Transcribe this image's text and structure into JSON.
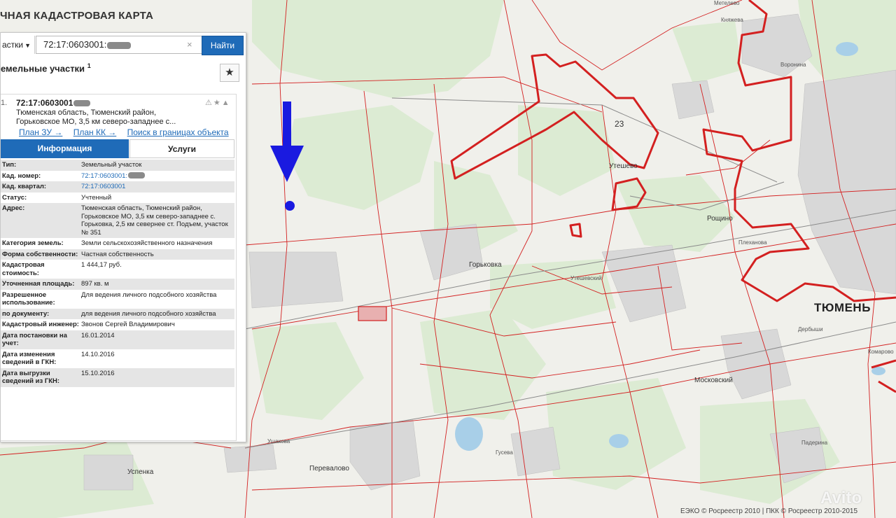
{
  "header": {
    "title": "ЧНАЯ КАДАСТРОВАЯ КАРТА"
  },
  "search": {
    "type_select": "астки",
    "value": "72:17:0603001:",
    "clear_glyph": "×",
    "button": "Найти"
  },
  "results": {
    "heading": "емельные участки",
    "count": "1",
    "star_glyph": "★"
  },
  "card": {
    "index": "1.",
    "id": "72:17:0603001",
    "address": "Тюменская область, Тюменский район, Горьковское МО, 3,5 км северо-западнее с...",
    "icons": "⚠★▲",
    "links": [
      "План ЗУ →",
      "План КК →",
      "Поиск в границах объекта →"
    ]
  },
  "tabs": [
    {
      "label": "Информация",
      "active": true
    },
    {
      "label": "Услуги",
      "active": false
    }
  ],
  "info": [
    {
      "key": "Тип:",
      "value": "Земельный участок"
    },
    {
      "key": "Кад. номер:",
      "value": "72:17:0603001:",
      "masked": true,
      "link": true
    },
    {
      "key": "Кад. квартал:",
      "value": "72:17:0603001",
      "link": true
    },
    {
      "key": "Статус:",
      "value": "Учтенный"
    },
    {
      "key": "Адрес:",
      "value": "Тюменская область, Тюменский район, Горьковское МО, 3,5 км северо-западнее с. Горьковка, 2,5 км севернее ст. Подъем, участок № 351"
    },
    {
      "key": "Категория земель:",
      "value": "Земли сельскохозяйственного назначения"
    },
    {
      "key": "Форма собственности:",
      "value": "Частная собственность"
    },
    {
      "key": "Кадастровая стоимость:",
      "value": "1 444,17 руб."
    },
    {
      "key": "Уточненная площадь:",
      "value": "897 кв. м"
    },
    {
      "key": "Разрешенное использование:",
      "value": "Для ведения личного подсобного хозяйства"
    },
    {
      "key": "по документу:",
      "value": "для ведения личного подсобного хозяйства"
    },
    {
      "key": "Кадастровый инженер:",
      "value": "Звонов Сергей Владимирович"
    },
    {
      "key": "Дата постановки на учет:",
      "value": "16.01.2014"
    },
    {
      "key": "Дата изменения сведений в ГКН:",
      "value": "14.10.2016"
    },
    {
      "key": "Дата выгрузки сведений из ГКН:",
      "value": "15.10.2016"
    }
  ],
  "map": {
    "labels": {
      "metelevo": "Метелево",
      "knyazheva": "Княжева",
      "voronina": "Воронина",
      "utesheva": "Утешево",
      "roschino": "Рощино",
      "plekhanova": "Плеханова",
      "gorkovka": "Горьковка",
      "utesheva_small": "Утешевский",
      "tyumen": "ТЮМЕНЬ",
      "derbyshi": "Дербыши",
      "komarovo": "Комарово",
      "moskovsky": "Московский",
      "paderina": "Падерина",
      "ushakova": "Ушакова",
      "uspenka": "Успенка",
      "perevalovo": "Перевалово",
      "guseva": "Гусева",
      "block_num": "23"
    },
    "attribution": "ЕЭКО © Росреестр 2010 | ПКК © Росреестр 2010-2015",
    "watermark": "Avito",
    "colors": {
      "boundary": "#d32020",
      "water": "#a8cfe8",
      "forest": "#dcebd3",
      "marker": "#1a1ae0",
      "accent": "#1f6bb8"
    }
  }
}
